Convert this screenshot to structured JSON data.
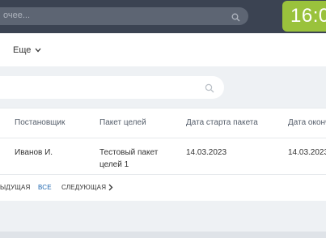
{
  "header": {
    "search_placeholder": "очее...",
    "clock": "16:0"
  },
  "menu": {
    "more_label": "Еще"
  },
  "filter": {
    "placeholder": ""
  },
  "table": {
    "columns": [
      "Постановщик",
      "Пакет целей",
      "Дата старта пакета",
      "Дата оконч"
    ],
    "rows": [
      [
        "Иванов И.",
        "Тестовый пакет целей 1",
        "14.03.2023",
        "14.03.2023"
      ]
    ]
  },
  "pagination": {
    "prev_label": "ыдущая",
    "all_label": "все",
    "next_label": "следующая"
  },
  "colors": {
    "topbar": "#3b4352",
    "clock_bg": "#9ac23c",
    "link": "#2067b0"
  }
}
